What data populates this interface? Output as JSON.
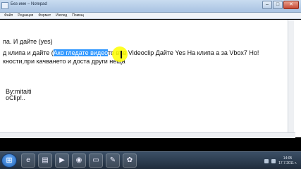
{
  "window": {
    "title": "Без име – Notepad"
  },
  "window_buttons": {
    "minimize": "–",
    "maximize": "□",
    "close": "✕"
  },
  "menu": [
    {
      "label": "Файл"
    },
    {
      "label": "Редакция"
    },
    {
      "label": "Формат"
    },
    {
      "label": "Изглед"
    },
    {
      "label": "Помощ"
    }
  ],
  "editor": {
    "line1": "па. И дайте (yes)",
    "line2_before": "д клипа и дайте (",
    "line2_selected": "Ако гледате видео",
    "line2_after": "то във Videoclip Дайте Yes На клипа а за Vbox7 Но!",
    "line3": "кности,при качването и доста други неща",
    "line4": "By:mitaiti",
    "line5": "oClip!.."
  },
  "taskbar": {
    "start_glyph": "⊞",
    "buttons": [
      {
        "name": "ie-icon",
        "glyph": "e"
      },
      {
        "name": "explorer-icon",
        "glyph": "▤"
      },
      {
        "name": "media-player-icon",
        "glyph": "▶"
      },
      {
        "name": "firefox-icon",
        "glyph": "◉"
      },
      {
        "name": "folder-icon",
        "glyph": "▭"
      },
      {
        "name": "notepad-icon",
        "glyph": "✎"
      },
      {
        "name": "paint-icon",
        "glyph": "✿"
      }
    ],
    "clock_time": "14:05",
    "clock_date": "17.7.2011 г."
  },
  "colors": {
    "selection": "#3399ff",
    "cursor_highlight": "#ffff00"
  }
}
